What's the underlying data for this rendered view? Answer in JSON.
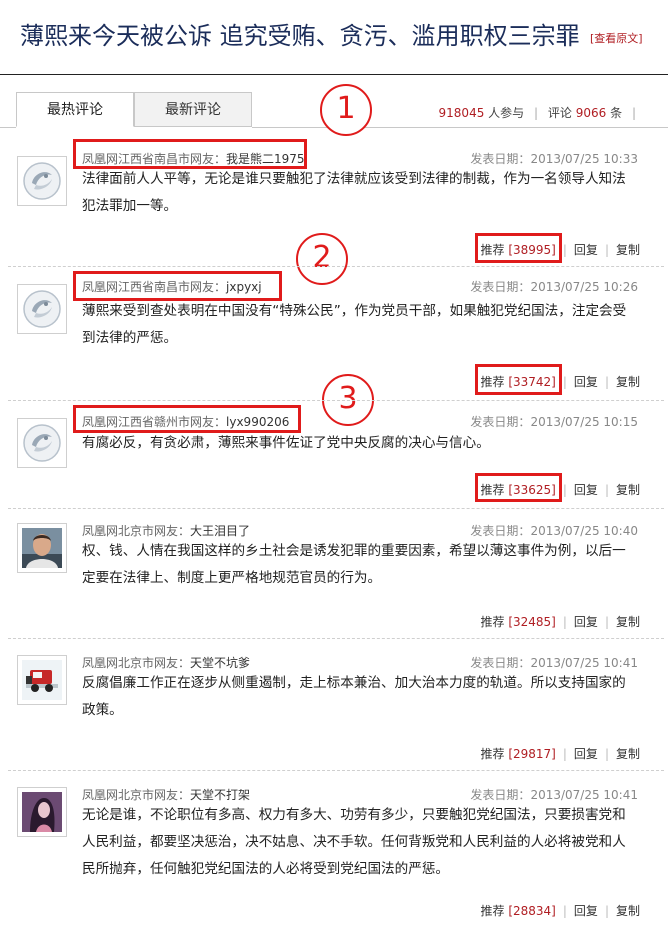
{
  "article": {
    "title": "薄熙来今天被公诉 追究受贿、贪污、滥用职权三宗罪",
    "view_original": "[查看原文]"
  },
  "tabs": {
    "hot": "最热评论",
    "new": "最新评论"
  },
  "stats": {
    "participants": "918045",
    "participants_label": "人参与",
    "comments_label": "评论",
    "comments": "9066",
    "comments_unit": "条"
  },
  "annotations": {
    "one": "1",
    "two": "2",
    "three": "3"
  },
  "labels": {
    "date_prefix": "发表日期：",
    "recommend": "推荐",
    "reply": "回复",
    "copy": "复制"
  },
  "comments": [
    {
      "location": "凤凰网江西省南昌市网友：",
      "name": "我是熊二1975",
      "date": "2013/07/25 10:33",
      "text": "法律面前人人平等，无论是谁只要触犯了法律就应该受到法律的制裁，作为一名领导人知法犯法罪加一等。",
      "votes": "[38995]",
      "avatar": "phoenix-logo-icon"
    },
    {
      "location": "凤凰网江西省南昌市网友：",
      "name": "jxpyxj",
      "date": "2013/07/25 10:26",
      "text": "薄熙来受到查处表明在中国没有“特殊公民”，作为党员干部，如果触犯党纪国法，注定会受到法律的严惩。",
      "votes": "[33742]",
      "avatar": "phoenix-logo-icon"
    },
    {
      "location": "凤凰网江西省赣州市网友：",
      "name": "lyx990206",
      "date": "2013/07/25 10:15",
      "text": "有腐必反，有贪必肃，薄熙来事件佐证了党中央反腐的决心与信心。",
      "votes": "[33625]",
      "avatar": "phoenix-logo-icon"
    },
    {
      "location": "凤凰网北京市网友：",
      "name": "大王泪目了",
      "date": "2013/07/25 10:40",
      "text": "权、钱、人情在我国这样的乡土社会是诱发犯罪的重要因素，希望以薄这事件为例，以后一定要在法律上、制度上更严格地规范官员的行为。",
      "votes": "[32485]",
      "avatar": "man-photo-avatar"
    },
    {
      "location": "凤凰网北京市网友：",
      "name": "天堂不坑爹",
      "date": "2013/07/25 10:41",
      "text": "反腐倡廉工作正在逐步从侧重遏制，走上标本兼治、加大治本力度的轨道。所以支持国家的政策。",
      "votes": "[29817]",
      "avatar": "truck-avatar"
    },
    {
      "location": "凤凰网北京市网友：",
      "name": "天堂不打架",
      "date": "2013/07/25 10:41",
      "text": "无论是谁，不论职位有多高、权力有多大、功劳有多少，只要触犯党纪国法，只要损害党和人民利益，都要坚决惩治，决不姑息、决不手软。任何背叛党和人民利益的人必将被党和人民所抛弃，任何触犯党纪国法的人必将受到党纪国法的严惩。",
      "votes": "[28834]",
      "avatar": "woman-art-avatar"
    }
  ]
}
